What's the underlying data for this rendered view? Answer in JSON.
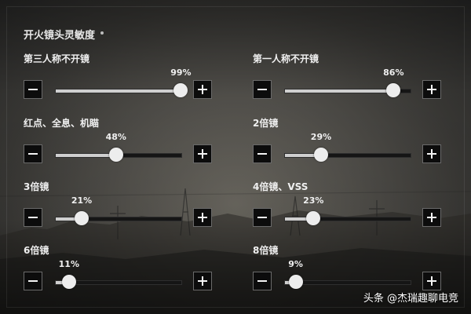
{
  "panel": {
    "title": "开火镜头灵敏度"
  },
  "settings": [
    {
      "label": "第三人称不开镜",
      "value_text": "99%",
      "value": 0.99
    },
    {
      "label": "第一人称不开镜",
      "value_text": "86%",
      "value": 0.86
    },
    {
      "label": "红点、全息、机瞄",
      "value_text": "48%",
      "value": 0.48
    },
    {
      "label": "2倍镜",
      "value_text": "29%",
      "value": 0.29
    },
    {
      "label": "3倍镜",
      "value_text": "21%",
      "value": 0.21
    },
    {
      "label": "4倍镜、VSS",
      "value_text": "23%",
      "value": 0.23
    },
    {
      "label": "6倍镜",
      "value_text": "11%",
      "value": 0.11
    },
    {
      "label": "8倍镜",
      "value_text": "9%",
      "value": 0.09
    }
  ],
  "watermark": "头条 @杰瑞趣聊电竞"
}
